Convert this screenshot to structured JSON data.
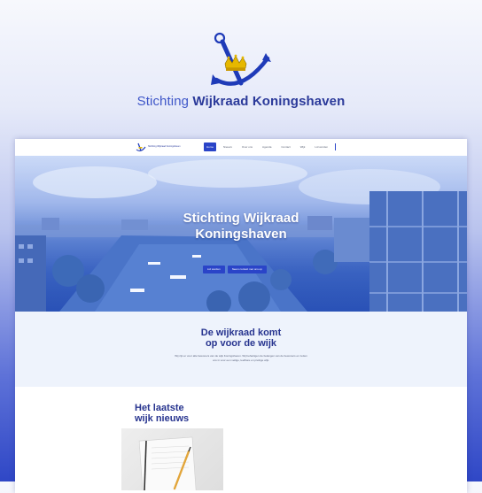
{
  "brand": {
    "title_light": "Stichting",
    "title_bold": "Wijkraad Koningshaven",
    "logo_icon": "anchor-crown-icon"
  },
  "colors": {
    "brand_blue": "#2a44c8",
    "dark_blue": "#27348f",
    "crown_gold": "#e6b800"
  },
  "site": {
    "nav": {
      "logo_text": "Stichting Wijkraad Koningshaven",
      "items": [
        "Home",
        "Nieuws",
        "Over ons",
        "Agenda",
        "Contact",
        "Wijk",
        "Lid worden"
      ]
    },
    "hero": {
      "title_line1": "Stichting Wijkraad",
      "title_line2": "Koningshaven",
      "button_primary": "Lid worden",
      "button_secondary": "Neem contact met ons op"
    },
    "intro": {
      "title_line1": "De wijkraad komt",
      "title_line2": "op voor de wijk",
      "text": "Wij zijn er voor alle bewoners van de wijk Koningshaven. Wij behartigen de belangen van de bewoners en zetten ons in voor een veilige, leefbare en prettige wijk."
    },
    "news": {
      "title_line1": "Het laatste",
      "title_line2": "wijk nieuws",
      "image_icon": "notebook-pen-photo"
    }
  }
}
